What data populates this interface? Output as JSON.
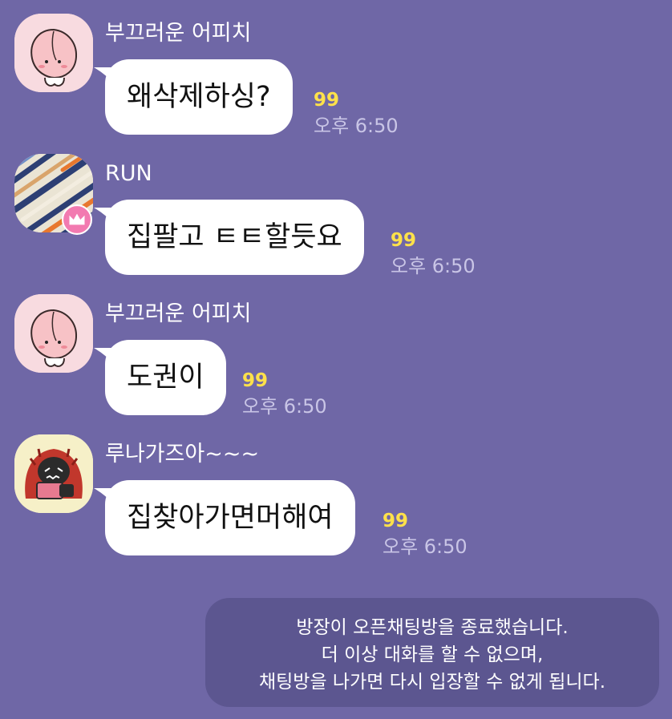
{
  "messages": [
    {
      "sender": "부끄러운 어피치",
      "avatar_icon": "peach-character-icon",
      "text": "왜삭제하싱?",
      "unread": "99",
      "time": "오후 6:50"
    },
    {
      "sender": "RUN",
      "avatar_icon": "striped-pattern-icon",
      "badge_icon": "crown-icon",
      "text": "집팔고 ㅌㅌ할듯요",
      "unread": "99",
      "time": "오후 6:50"
    },
    {
      "sender": "부끄러운 어피치",
      "avatar_icon": "peach-character-icon",
      "text": "도권이",
      "unread": "99",
      "time": "오후 6:50"
    },
    {
      "sender": "루나가즈아~~~",
      "avatar_icon": "angry-character-icon",
      "text": "집찾아가면머해여",
      "unread": "99",
      "time": "오후 6:50"
    }
  ],
  "notice": {
    "line1": "방장이 오픈채팅방을 종료했습니다.",
    "line2": "더 이상 대화를 할 수 없으며,",
    "line3": "채팅방을 나가면 다시 입장할 수 없게 됩니다."
  },
  "colors": {
    "background": "#6f67a6",
    "bubble": "#ffffff",
    "unread": "#ffe14a",
    "time": "#c9c5e6",
    "notice_bg": "#5c5690",
    "owner_badge": "#f27ab0"
  }
}
